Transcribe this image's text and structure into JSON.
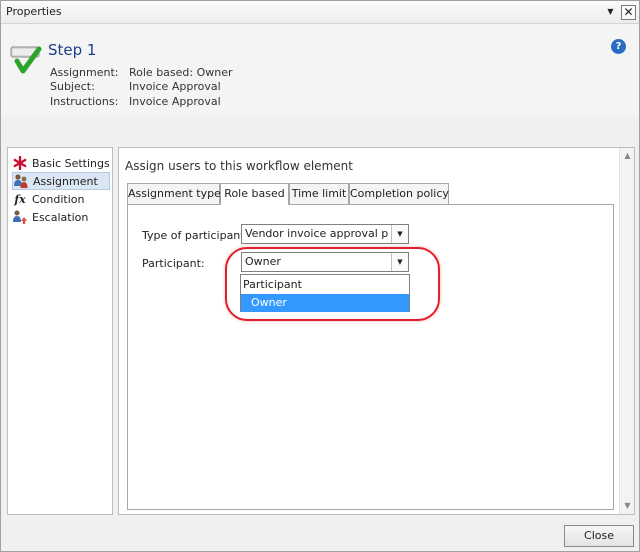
{
  "window": {
    "title": "Properties"
  },
  "header": {
    "step_title": "Step 1",
    "assignment_label": "Assignment:",
    "assignment_value": "Role based: Owner",
    "subject_label": "Subject:",
    "subject_value": "Invoice Approval",
    "instructions_label": "Instructions:",
    "instructions_value": "Invoice Approval"
  },
  "nav": {
    "items": [
      {
        "label": "Basic Settings",
        "icon": "red-asterisk-icon"
      },
      {
        "label": "Assignment",
        "icon": "users-icon"
      },
      {
        "label": "Condition",
        "icon": "fx-icon"
      },
      {
        "label": "Escalation",
        "icon": "escalation-icon"
      }
    ],
    "selected_index": 1
  },
  "main": {
    "heading": "Assign users to this workflow element",
    "tabs": [
      {
        "label": "Assignment type"
      },
      {
        "label": "Role based"
      },
      {
        "label": "Time limit"
      },
      {
        "label": "Completion policy"
      }
    ],
    "active_tab": "Role based",
    "type_of_participant_label": "Type of participant:",
    "type_of_participant_value": "Vendor invoice approval prov",
    "participant_label": "Participant:",
    "participant_value": "Owner",
    "dropdown_options": [
      {
        "label": "Participant"
      },
      {
        "label": "Owner"
      }
    ],
    "dropdown_selected": "Owner"
  },
  "footer": {
    "close_label": "Close"
  },
  "colors": {
    "accent_blue": "#1f3e8a",
    "selection_blue": "#3399ff",
    "highlight_red": "#e0202a"
  }
}
